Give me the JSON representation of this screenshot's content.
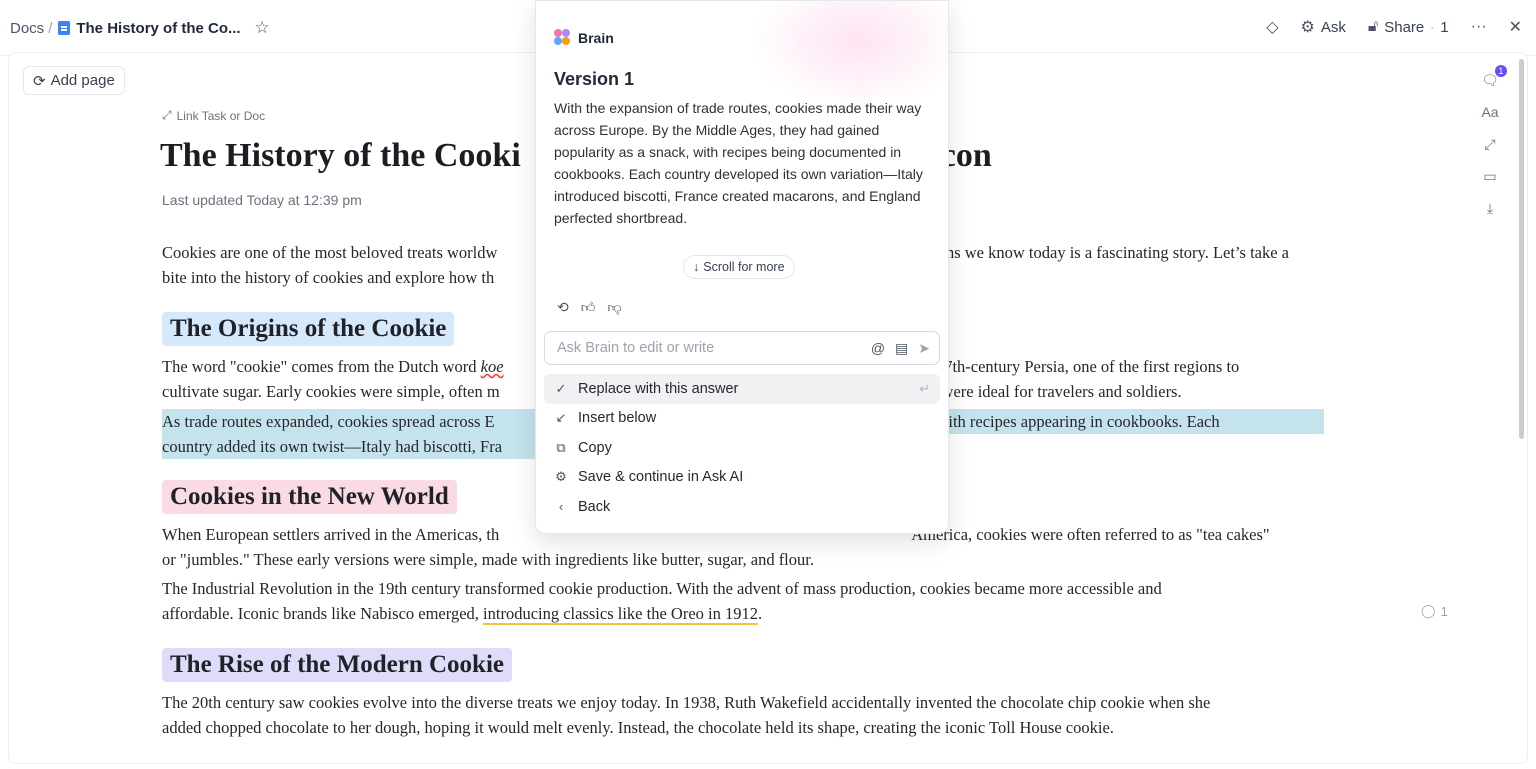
{
  "topbar": {
    "breadcrumb_root": "Docs",
    "breadcrumb_sep": "/",
    "doc_title": "The History of the Co...",
    "ask_label": "Ask",
    "share_label": "Share",
    "share_count": "1"
  },
  "page": {
    "add_page_label": "Add page",
    "link_task_label": "Link Task or Doc",
    "title": "The History of the Cookie: From Ancient Treat to Icon",
    "title_left": "The History of the Cooki",
    "title_right": "con",
    "last_updated": "Last updated Today at 12:39 pm",
    "intro_line1_a": "Cookies are one of the most beloved treats worldw",
    "intro_line1_b": "g icons we know today is a fascinating story. Let’s take a",
    "intro_line2": "bite into the history of cookies and explore how th",
    "sections": [
      {
        "heading": "The Origins of the Cookie",
        "p1_line1_a": "The word \"cookie\" comes from the Dutch word ",
        "p1_word": "koe",
        "p1_line1_b": "ck to 7th-century Persia, one of the first regions to",
        "p1_line2_a": "cultivate sugar. Early cookies were simple, often m",
        "p1_line2_b": "treats were ideal for travelers and soldiers.",
        "p2_line1_a": "As trade routes expanded, cookies spread across E",
        "p2_line1_b": "snack, with recipes appearing in cookbooks. Each",
        "p2_line2": "country added its own twist—Italy had biscotti, Fra"
      },
      {
        "heading": "Cookies in the New World",
        "p1_line1_a": "When European settlers arrived in the Americas, th",
        "p1_line1_b": "America, cookies were often referred to as \"tea cakes\"",
        "p1_line2": "or \"jumbles.\" These early versions were simple, made with ingredients like butter, sugar, and flour.",
        "p2_line1": "The Industrial Revolution in the 19th century transformed cookie production. With the advent of mass production, cookies became more accessible and",
        "p2_line2_a": "affordable. Iconic brands like Nabisco emerged, ",
        "p2_line2_ul": "introducing classics like the Oreo in 1912",
        "p2_line2_b": "."
      },
      {
        "heading": "The Rise of the Modern Cookie",
        "p1_line1": "The 20th century saw cookies evolve into the diverse treats we enjoy today. In 1938, Ruth Wakefield accidentally invented the chocolate chip cookie when she",
        "p1_line2": "added chopped chocolate to her dough, hoping it would melt evenly. Instead, the chocolate held its shape, creating the iconic Toll House cookie."
      }
    ],
    "comment_count": "1"
  },
  "rail": {
    "comments_badge": "1",
    "font_label": "Aa"
  },
  "brain": {
    "title": "Brain",
    "version_label": "Version 1",
    "answer_text": "With the expansion of trade routes, cookies made their way across Europe. By the Middle Ages, they had gained popularity as a snack, with recipes being documented in cookbooks. Each country developed its own variation—Italy introduced biscotti, France created macarons, and England perfected shortbread.",
    "scroll_more_label": "Scroll for more",
    "input_placeholder": "Ask Brain to edit or write",
    "menu": [
      {
        "label": "Replace with this answer",
        "icon": "check-icon"
      },
      {
        "label": "Insert below",
        "icon": "arrow-down-left-icon"
      },
      {
        "label": "Copy",
        "icon": "copy-icon"
      },
      {
        "label": "Save & continue in Ask AI",
        "icon": "ai-icon"
      },
      {
        "label": "Back",
        "icon": "chevron-left-icon"
      }
    ]
  },
  "colors": {
    "accent": "#6d4aff",
    "heading1_bg": "#d6e8fb",
    "heading2_bg": "#fbdbe3",
    "heading3_bg": "#dedcf8",
    "selection_bg": "#c5e3ec"
  }
}
